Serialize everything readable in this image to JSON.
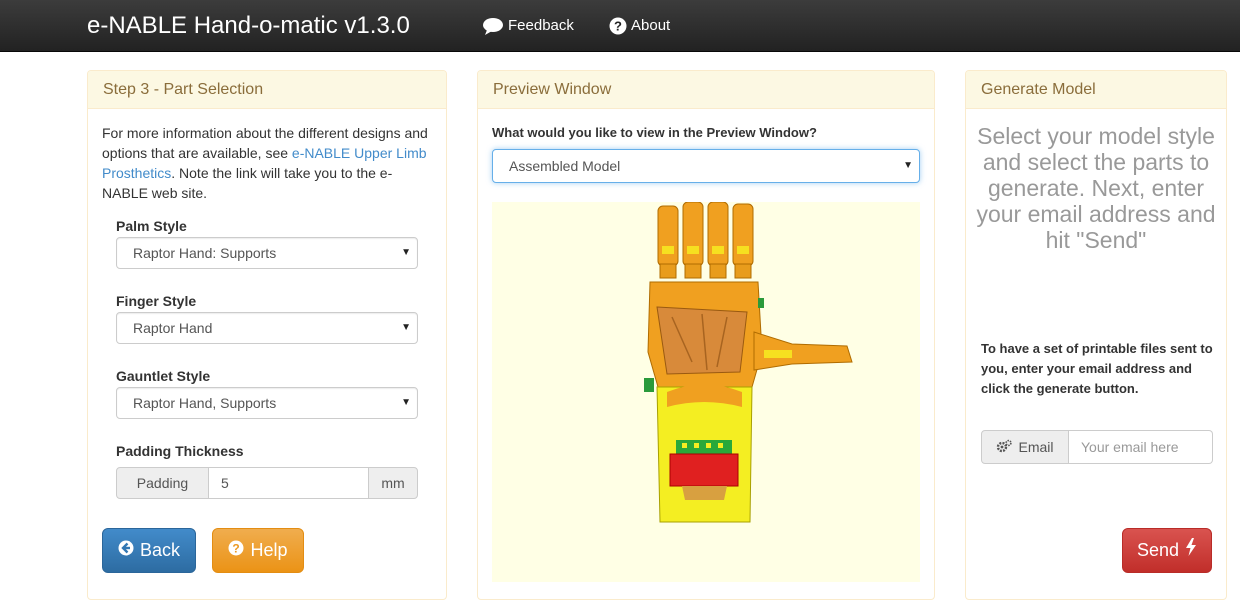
{
  "navbar": {
    "brand": "e-NABLE Hand-o-matic v1.3.0",
    "feedback_label": "Feedback",
    "about_label": "About"
  },
  "step3": {
    "heading": "Step 3 - Part Selection",
    "info_prefix": "For more information about the different designs and options that are available, see ",
    "info_link": "e-NABLE Upper Limb Prosthetics",
    "info_suffix": ". Note the link will take you to the e-NABLE web site.",
    "palm_label": "Palm Style",
    "palm_value": "Raptor Hand: Supports",
    "finger_label": "Finger Style",
    "finger_value": "Raptor Hand",
    "gauntlet_label": "Gauntlet Style",
    "gauntlet_value": "Raptor Hand, Supports",
    "padding_label": "Padding Thickness",
    "padding_addon": "Padding",
    "padding_value": "5",
    "padding_unit": "mm",
    "back_label": "Back",
    "help_label": "Help"
  },
  "preview": {
    "heading": "Preview Window",
    "question": "What would you like to view in the Preview Window?",
    "selected": "Assembled Model"
  },
  "generate": {
    "heading": "Generate Model",
    "prompt": "Select your model style and select the parts to generate. Next, enter your email address and hit \"Send\"",
    "instructions": "To have a set of printable files sent to you, enter your email address and click the generate button.",
    "email_addon": "Email",
    "email_placeholder": "Your email here",
    "send_label": "Send"
  },
  "icons": {
    "feedback": "speech-bubble-icon",
    "about": "question-circle-icon",
    "back": "circle-arrow-left-icon",
    "help": "question-circle-icon",
    "email": "gears-icon",
    "send": "lightning-icon",
    "caret": "caret-down-icon"
  },
  "colors": {
    "navbar": "#222222",
    "panel_heading_bg": "#fcf8e3",
    "panel_heading_text": "#8a6d3b",
    "link": "#428bca",
    "primary": "#428bca",
    "warning": "#f0ad4e",
    "danger": "#d9534f",
    "viewer_bg": "#ffffe5"
  }
}
